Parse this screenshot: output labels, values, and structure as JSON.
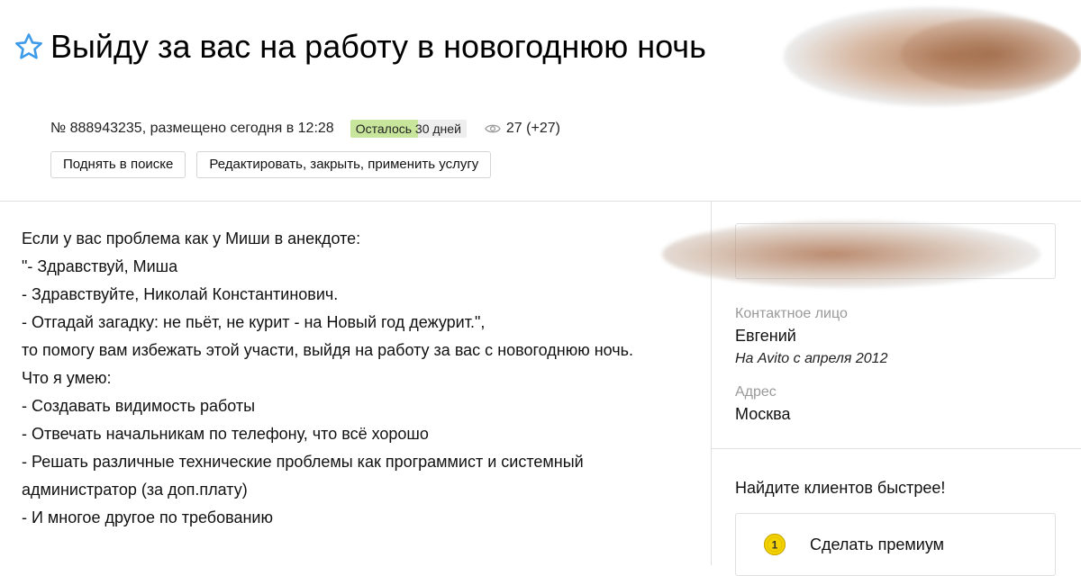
{
  "listing": {
    "title": "Выйду за вас на работу в новогоднюю ночь",
    "meta_text": "№ 888943235, размещено сегодня в 12:28",
    "days_left": "Осталось 30 дней",
    "views": "27 (+27)"
  },
  "actions": {
    "raise": "Поднять в поиске",
    "edit": "Редактировать, закрыть, применить услугу"
  },
  "description": {
    "lines": [
      "Если у вас проблема как у Миши в анекдоте:",
      "\"- Здравствуй, Миша",
      "- Здравствуйте, Николай Константинович.",
      "- Отгадай загадку: не пьёт, не курит - на Новый год дежурит.\",",
      "то помогу вам избежать этой участи, выйдя на работу за вас с новогоднюю ночь.",
      "Что я умею:",
      "- Создавать видимость работы",
      "- Отвечать начальникам по телефону, что всё хорошо",
      "- Решать различные технические проблемы как программист и системный администратор (за доп.плату)",
      "- И многое другое по требованию"
    ]
  },
  "sidebar": {
    "contact_label": "Контактное лицо",
    "contact_name": "Евгений",
    "contact_since": "На Avito с апреля 2012",
    "address_label": "Адрес",
    "address_value": "Москва",
    "promo_title": "Найдите клиентов быстрее!",
    "premium_label": "Сделать премиум",
    "premium_badge": "1"
  },
  "colors": {
    "star": "#3d9be9",
    "days_left_fill": "#c7e69c",
    "premium_badge": "#f5d300",
    "border": "#e0e0e0",
    "muted_text": "#999999"
  },
  "icons": {
    "favorite": "star-outline-icon",
    "views": "eye-icon",
    "premium": "coin-icon"
  }
}
